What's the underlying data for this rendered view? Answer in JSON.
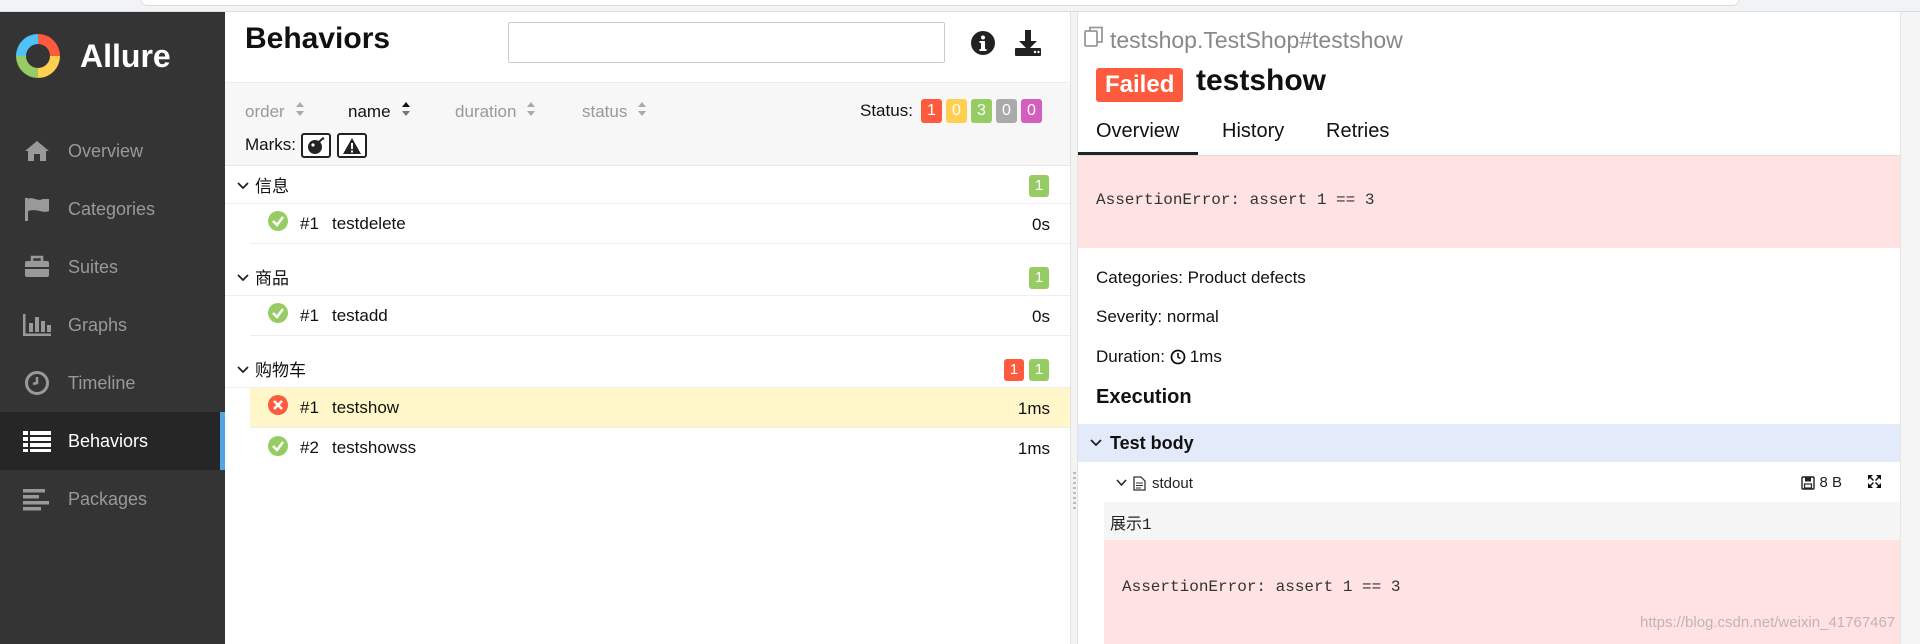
{
  "app": {
    "name": "Allure"
  },
  "sidebar": {
    "items": [
      {
        "label": "Overview",
        "icon": "home-icon",
        "active": false
      },
      {
        "label": "Categories",
        "icon": "flag-icon",
        "active": false
      },
      {
        "label": "Suites",
        "icon": "briefcase-icon",
        "active": false
      },
      {
        "label": "Graphs",
        "icon": "bar-chart-icon",
        "active": false
      },
      {
        "label": "Timeline",
        "icon": "clock-icon",
        "active": false
      },
      {
        "label": "Behaviors",
        "icon": "list-icon",
        "active": true
      },
      {
        "label": "Packages",
        "icon": "align-left-icon",
        "active": false
      }
    ]
  },
  "behaviors": {
    "title": "Behaviors",
    "search": {
      "value": "",
      "placeholder": ""
    },
    "sort": {
      "order": "order",
      "name": "name",
      "duration": "duration",
      "status": "status",
      "active": "name"
    },
    "status_label": "Status:",
    "status_counts": [
      {
        "value": "1",
        "color": "#fd5a3e"
      },
      {
        "value": "0",
        "color": "#ffd050"
      },
      {
        "value": "3",
        "color": "#97cc64"
      },
      {
        "value": "0",
        "color": "#aaaaaa"
      },
      {
        "value": "0",
        "color": "#d35ebe"
      }
    ],
    "marks_label": "Marks:",
    "groups": [
      {
        "name": "信息",
        "counts": [
          {
            "value": "1",
            "color": "#97cc64"
          }
        ],
        "tests": [
          {
            "num": "#1",
            "name": "testdelete",
            "duration": "0s",
            "status": "passed",
            "selected": false
          }
        ]
      },
      {
        "name": "商品",
        "counts": [
          {
            "value": "1",
            "color": "#97cc64"
          }
        ],
        "tests": [
          {
            "num": "#1",
            "name": "testadd",
            "duration": "0s",
            "status": "passed",
            "selected": false
          }
        ]
      },
      {
        "name": "购物车",
        "counts": [
          {
            "value": "1",
            "color": "#fd5a3e"
          },
          {
            "value": "1",
            "color": "#97cc64"
          }
        ],
        "tests": [
          {
            "num": "#1",
            "name": "testshow",
            "duration": "1ms",
            "status": "failed",
            "selected": true
          },
          {
            "num": "#2",
            "name": "testshowss",
            "duration": "1ms",
            "status": "passed",
            "selected": false
          }
        ]
      }
    ]
  },
  "detail": {
    "full_name": "testshop.TestShop#testshow",
    "status": "Failed",
    "title": "testshow",
    "tabs": [
      "Overview",
      "History",
      "Retries"
    ],
    "active_tab": "Overview",
    "error": "AssertionError: assert 1 == 3",
    "categories_label": "Categories:",
    "categories_value": "Product defects",
    "severity_label": "Severity:",
    "severity_value": "normal",
    "duration_label": "Duration:",
    "duration_value": "1ms",
    "execution_title": "Execution",
    "test_body": "Test body",
    "attachment": {
      "name": "stdout",
      "size": "8 B",
      "content": "展示1"
    },
    "attachment_error": "AssertionError: assert 1 == 3"
  },
  "watermark": "https://blog.csdn.net/weixin_41767467",
  "colors": {
    "sidebar": "#343434",
    "failed": "#fd5a3e",
    "passed": "#97cc64",
    "active_bar": "#4fa6e3"
  }
}
